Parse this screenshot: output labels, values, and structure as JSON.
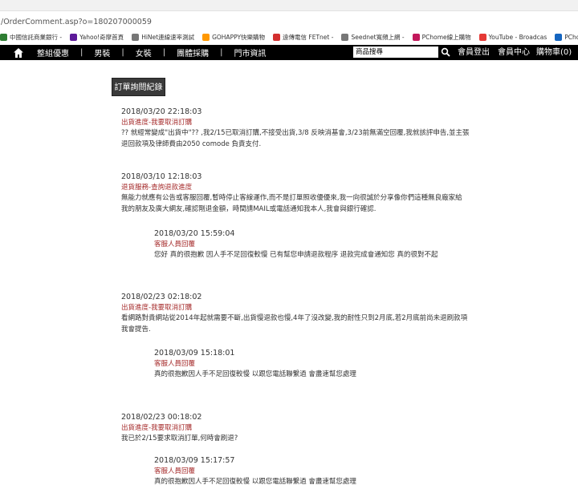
{
  "browser": {
    "url": "/OrderComment.asp?o=180207000059",
    "bookmarks": [
      {
        "label": "中國信託商業銀行 -",
        "icon": "bank-icon",
        "color": "#2e7d32"
      },
      {
        "label": "Yahoo!奇摩首頁",
        "icon": "yahoo-icon",
        "color": "#5c1a99"
      },
      {
        "label": "HiNet連線速率測試",
        "icon": "page-icon",
        "color": "#777777"
      },
      {
        "label": "GOHAPPY快樂購物",
        "icon": "gohappy-icon",
        "color": "#ff9800"
      },
      {
        "label": "遠傳電信 FETnet -",
        "icon": "fetnet-icon",
        "color": "#d32f2f"
      },
      {
        "label": "Seednet寬頻上網 -",
        "icon": "page-icon",
        "color": "#777777"
      },
      {
        "label": "PChome線上購物",
        "icon": "pchome-icon",
        "color": "#c2185b"
      },
      {
        "label": "YouTube - Broadcas",
        "icon": "youtube-icon",
        "color": "#e53935"
      },
      {
        "label": "PChome",
        "icon": "pchome-p-icon",
        "color": "#1565c0"
      }
    ]
  },
  "nav": {
    "home_icon": "home-icon",
    "items": [
      "整組優惠",
      "男裝",
      "女裝",
      "團體採購",
      "門市資訊"
    ],
    "search_value": "商品搜尋",
    "search_icon": "search-icon",
    "logout": "會員登出",
    "member": "會員中心",
    "cart": "購物車(0)"
  },
  "page": {
    "section_title": "訂單詢問紀錄"
  },
  "entries": [
    {
      "date": "2018/03/20 22:18:03",
      "subject": "出貨進度-我要取消訂購",
      "lines": [
        "?? 就經常變成\"出貨中\"?? ,我2/15已取消訂購,不接受出貨,3/8 反映消基會,3/23前無滿空回覆,我就該評申告,並主張",
        "退回款項及律師費由2050 comode 負責支付."
      ]
    },
    {
      "date": "2018/03/10 12:18:03",
      "subject": "退貨服務-查詢退款進度",
      "lines": [
        "無能力就應有公告或客服回覆,暫時停止客線運作,而不是訂單照收優優來,我一向很誠於分享像你們這種無良廠家給",
        "我的朋友及廣大網友,確認剛退金額，時間請MAIL或電話通知我本人,我會與銀行確認."
      ],
      "reply": {
        "date": "2018/03/20 15:59:04",
        "subject": "客服人員回覆",
        "lines": [
          "您好 真的很抱歉 因人手不足回復較慢 已有幫您申請退款程序 退款完成會通知您 真的很對不起"
        ]
      }
    },
    {
      "date": "2018/02/23 02:18:02",
      "subject": "出貨進度-我要取消訂購",
      "lines": [
        "看網路對貴網站從2014年起就需要不斷,出貨慢退款也慢,4年了沒改變,我的耐性只到2月底,若2月底前尚未退刷款項",
        "我會提告."
      ],
      "reply": {
        "date": "2018/03/09 15:18:01",
        "subject": "客服人員回覆",
        "lines": [
          "真的很抱歉因人手不足回復較慢 以跟您電話聯繫過 會盡速幫您處理"
        ]
      }
    },
    {
      "date": "2018/02/23 00:18:02",
      "subject": "出貨進度-我要取消訂購",
      "lines": [
        "我已於2/15要求取消訂單,何時會刷退?"
      ],
      "reply": {
        "date": "2018/03/09 15:17:57",
        "subject": "客服人員回覆",
        "lines": [
          "真的很抱歉因人手不足回復較慢 以跟您電話聯繫過 會盡速幫您處理"
        ]
      }
    }
  ]
}
